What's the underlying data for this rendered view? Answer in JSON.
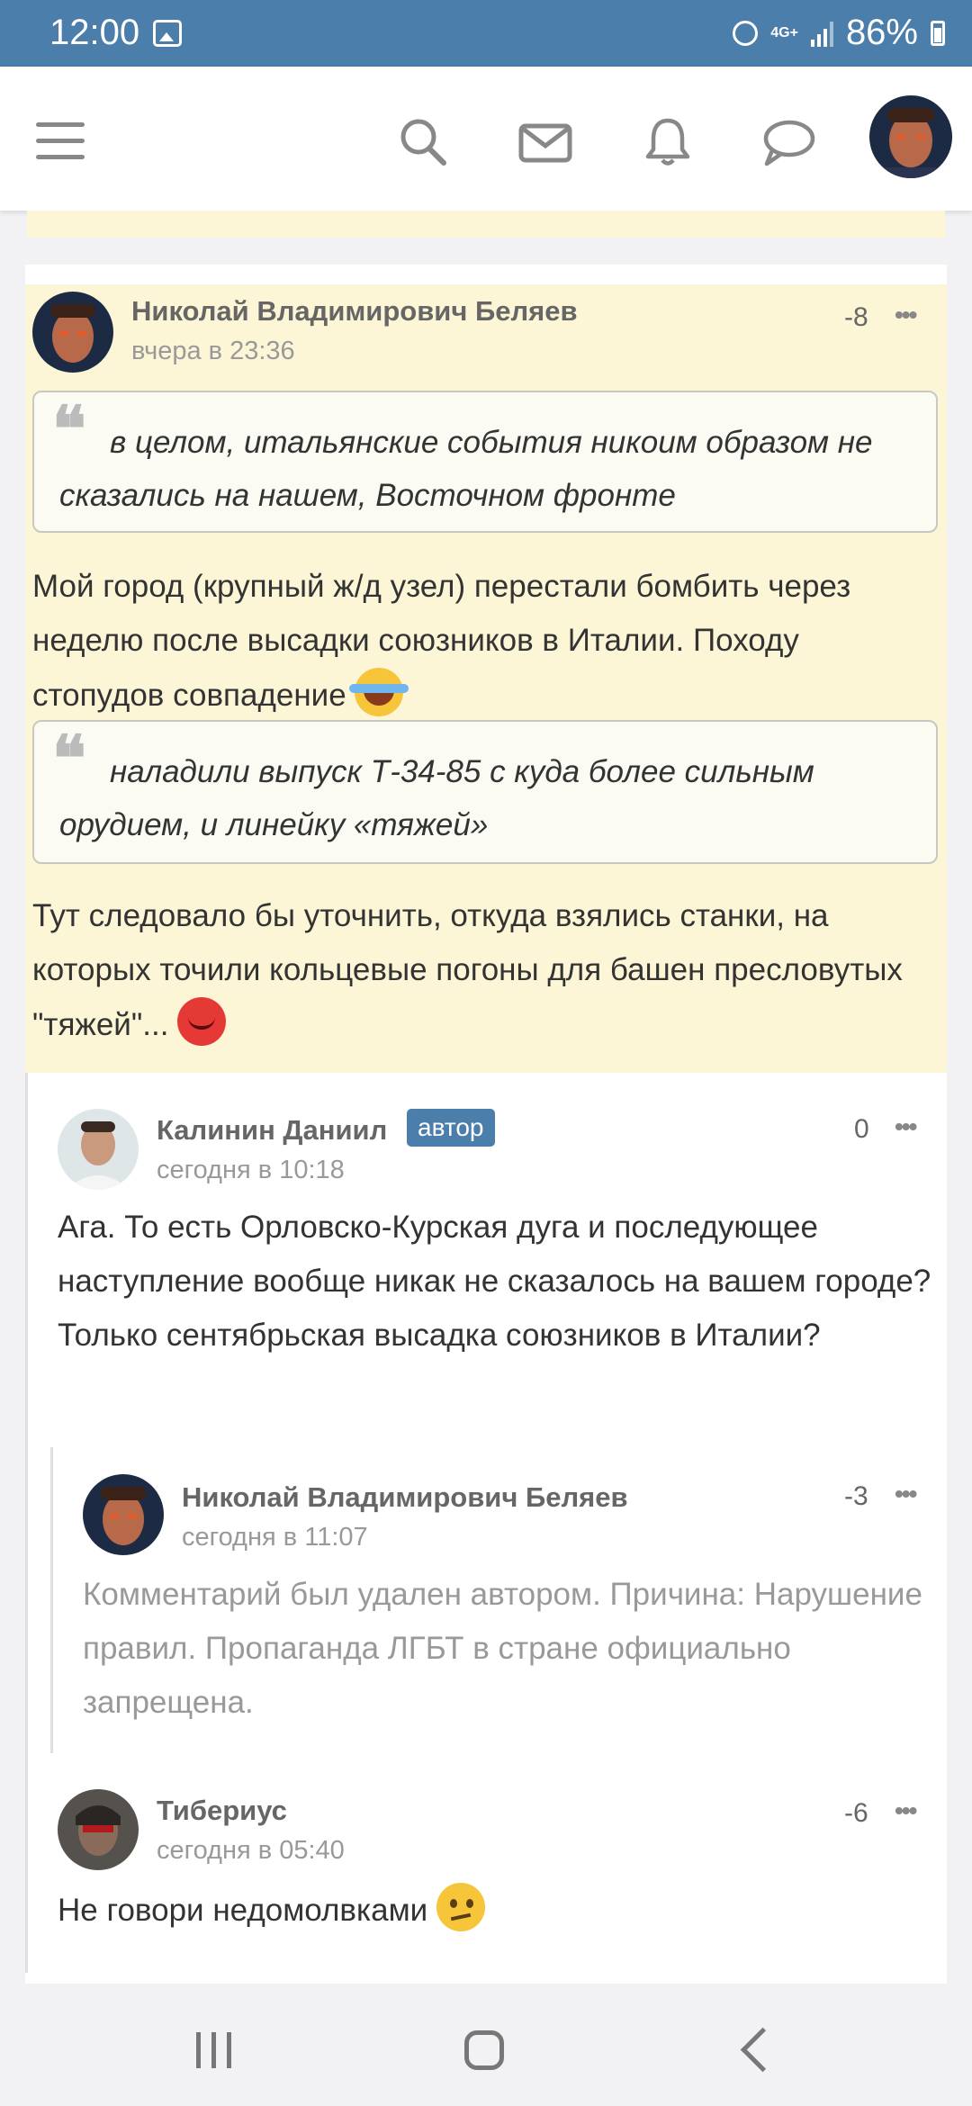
{
  "status_bar": {
    "time": "12:00",
    "network": "4G+",
    "battery": "86%"
  },
  "top_bar": {
    "icons": [
      "menu-icon",
      "search-icon",
      "mail-icon",
      "bell-icon",
      "chat-icon",
      "avatar"
    ]
  },
  "comments": [
    {
      "author": "Николай Владимирович Беляев",
      "date": "вчера в 23:36",
      "score": "-8",
      "quote1": "в целом, итальянские события никоим образом не сказались на нашем, Восточном фронте",
      "text1": "Мой город (крупный ж/д узел) перестали бомбить через неделю после высадки союзников в Италии. Походу стопудов совпадение",
      "quote2": "наладили выпуск Т-34-85 с куда более сильным орудием, и линейку «тяжей»",
      "text2": "Тут следовало бы уточнить, откуда взялись станки, на которых точили кольцевые погоны для башен пресловутых \"тяжей\"..."
    },
    {
      "author": "Калинин Даниил",
      "badge": "автор",
      "date": "сегодня в 10:18",
      "score": "0",
      "text": "Ага. То есть Орловско-Курская дуга и последующее наступление вообще никак не сказалось на вашем городе? Только сентябрьская высадка союзников в Италии?"
    },
    {
      "author": "Николай Владимирович Беляев",
      "date": "сегодня в 11:07",
      "score": "-3",
      "text": "Комментарий был удален автором. Причина: Нарушение правил. Пропаганда ЛГБТ в стране официально запрещена."
    },
    {
      "author": "Тибериус",
      "date": "сегодня в 05:40",
      "score": "-6",
      "text": "Не говори недомолвками"
    }
  ],
  "more_label": "•••",
  "quote_mark": "❝",
  "colors": {
    "accent": "#4b7eab",
    "highlight": "#fdf6d6"
  }
}
